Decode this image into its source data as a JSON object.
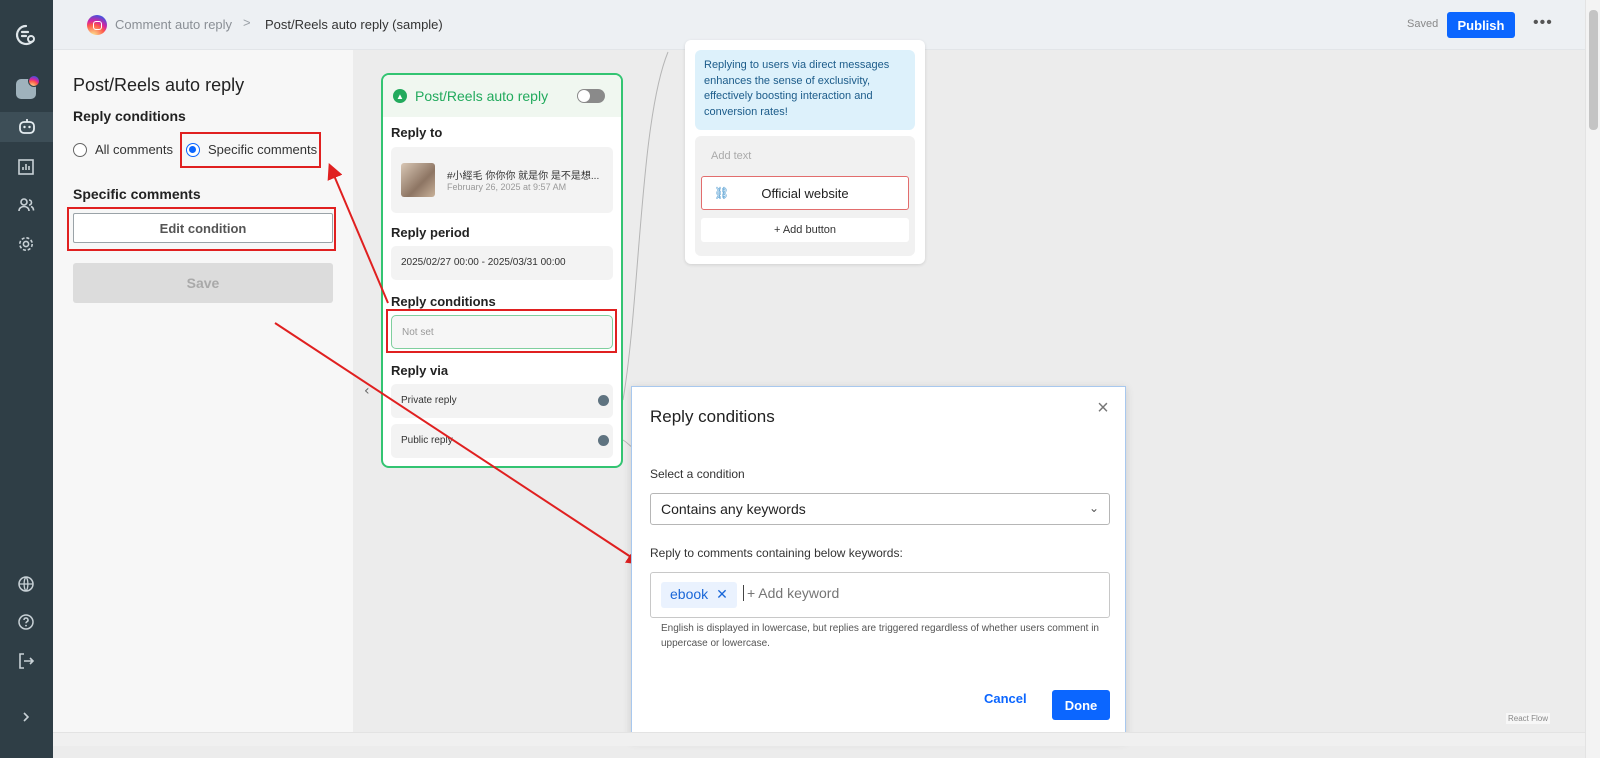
{
  "topbar": {
    "breadcrumb_parent": "Comment auto reply",
    "breadcrumb_sep": ">",
    "breadcrumb_current": "Post/Reels auto reply (sample)",
    "status": "Saved",
    "publish_label": "Publish",
    "more_label": "•••"
  },
  "panel": {
    "title": "Post/Reels auto reply",
    "reply_conditions_heading": "Reply conditions",
    "radio_all": "All comments",
    "radio_specific": "Specific comments",
    "specific_heading": "Specific comments",
    "edit_button": "Edit condition",
    "save_button": "Save"
  },
  "card": {
    "title": "Post/Reels auto reply",
    "reply_to_label": "Reply to",
    "post_caption": "#小經毛 你你你 就是你 是不是想...",
    "post_date": "February 26, 2025 at 9:57 AM",
    "reply_period_label": "Reply period",
    "reply_period_value": "2025/02/27 00:00 - 2025/03/31 00:00",
    "reply_conditions_label": "Reply conditions",
    "reply_conditions_value": "Not set",
    "reply_via_label": "Reply via",
    "private_reply": "Private reply",
    "public_reply": "Public reply"
  },
  "message": {
    "bubble_text": "Replying to users via direct messages enhances the sense of exclusivity, effectively boosting interaction and conversion rates!",
    "add_text_placeholder": "Add text",
    "website_button": "Official website",
    "add_button": "+  Add button"
  },
  "dialog": {
    "title": "Reply conditions",
    "select_label": "Select a condition",
    "select_value": "Contains any keywords",
    "keywords_label": "Reply to comments containing below keywords:",
    "keyword_tag": "ebook",
    "keyword_placeholder": "+ Add keyword",
    "hint": "English is displayed in lowercase, but replies are triggered regardless of whether users comment in uppercase or lowercase.",
    "cancel": "Cancel",
    "done": "Done"
  },
  "footer": {
    "react_flow": "React Flow"
  },
  "colors": {
    "primary": "#0b66ff",
    "success": "#22aa5d",
    "highlight": "#e02020",
    "rail": "#2f3e46"
  }
}
